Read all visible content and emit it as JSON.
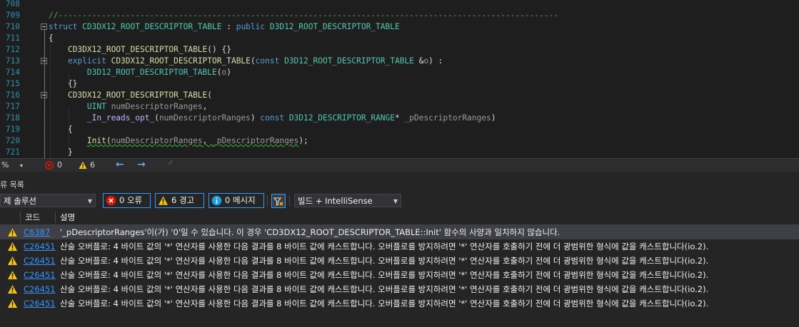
{
  "editor": {
    "lines": [
      {
        "n": "708",
        "t": []
      },
      {
        "n": "709",
        "t": [
          {
            "c": "comment",
            "s": "//--------------------------------------------------------------------------------------------------------"
          }
        ]
      },
      {
        "n": "710",
        "fold": true,
        "t": [
          {
            "c": "kw",
            "s": "struct "
          },
          {
            "c": "type",
            "s": "CD3DX12_ROOT_DESCRIPTOR_TABLE"
          },
          {
            "c": "plain",
            "s": " : "
          },
          {
            "c": "kw",
            "s": "public "
          },
          {
            "c": "type",
            "s": "D3D12_ROOT_DESCRIPTOR_TABLE"
          }
        ]
      },
      {
        "n": "711",
        "t": [
          {
            "c": "plain",
            "s": "{"
          }
        ]
      },
      {
        "n": "712",
        "t": [
          {
            "c": "plain",
            "s": "    "
          },
          {
            "c": "func",
            "s": "CD3DX12_ROOT_DESCRIPTOR_TABLE"
          },
          {
            "c": "plain",
            "s": "() {}"
          }
        ]
      },
      {
        "n": "713",
        "fold": true,
        "t": [
          {
            "c": "plain",
            "s": "    "
          },
          {
            "c": "kw",
            "s": "explicit "
          },
          {
            "c": "func",
            "s": "CD3DX12_ROOT_DESCRIPTOR_TABLE"
          },
          {
            "c": "plain",
            "s": "("
          },
          {
            "c": "kw",
            "s": "const "
          },
          {
            "c": "type",
            "s": "D3D12_ROOT_DESCRIPTOR_TABLE"
          },
          {
            "c": "plain",
            "s": " &"
          },
          {
            "c": "param",
            "s": "o"
          },
          {
            "c": "plain",
            "s": ") :"
          }
        ]
      },
      {
        "n": "714",
        "t": [
          {
            "c": "plain",
            "s": "        "
          },
          {
            "c": "type",
            "s": "D3D12_ROOT_DESCRIPTOR_TABLE"
          },
          {
            "c": "plain",
            "s": "("
          },
          {
            "c": "param",
            "s": "o"
          },
          {
            "c": "plain",
            "s": ")"
          }
        ]
      },
      {
        "n": "715",
        "t": [
          {
            "c": "plain",
            "s": "    {}"
          }
        ]
      },
      {
        "n": "716",
        "fold": true,
        "t": [
          {
            "c": "plain",
            "s": "    "
          },
          {
            "c": "func",
            "s": "CD3DX12_ROOT_DESCRIPTOR_TABLE"
          },
          {
            "c": "plain",
            "s": "("
          }
        ]
      },
      {
        "n": "717",
        "t": [
          {
            "c": "plain",
            "s": "        "
          },
          {
            "c": "type",
            "s": "UINT"
          },
          {
            "c": "plain",
            "s": " "
          },
          {
            "c": "param",
            "s": "numDescriptorRanges"
          },
          {
            "c": "plain",
            "s": ","
          }
        ]
      },
      {
        "n": "718",
        "t": [
          {
            "c": "plain",
            "s": "        "
          },
          {
            "c": "macro",
            "s": "_In_reads_opt_"
          },
          {
            "c": "plain",
            "s": "("
          },
          {
            "c": "param",
            "s": "numDescriptorRanges"
          },
          {
            "c": "plain",
            "s": ") "
          },
          {
            "c": "kw",
            "s": "const "
          },
          {
            "c": "type",
            "s": "D3D12_DESCRIPTOR_RANGE"
          },
          {
            "c": "plain",
            "s": "* "
          },
          {
            "c": "param",
            "s": "_pDescriptorRanges"
          },
          {
            "c": "plain",
            "s": ")"
          }
        ]
      },
      {
        "n": "719",
        "t": [
          {
            "c": "plain",
            "s": "    {"
          }
        ]
      },
      {
        "n": "720",
        "t": [
          {
            "c": "plain",
            "s": "        "
          },
          {
            "c": "func",
            "s": "Init",
            "sq": true
          },
          {
            "c": "plain",
            "s": "(",
            "sq": true
          },
          {
            "c": "param",
            "s": "numDescriptorRanges",
            "sq": true
          },
          {
            "c": "plain",
            "s": ", ",
            "sq": true
          },
          {
            "c": "param",
            "s": "_pDescriptorRanges",
            "sq": true
          },
          {
            "c": "plain",
            "s": ");"
          }
        ]
      },
      {
        "n": "721",
        "t": [
          {
            "c": "plain",
            "s": "    }"
          }
        ]
      }
    ]
  },
  "editor_status": {
    "zoom": "%",
    "errors": "0",
    "warnings": "6"
  },
  "panel": {
    "title": "류 목록"
  },
  "toolbar": {
    "scope": "제 솔루션",
    "errors_label": "0 오류",
    "warnings_label": "6 경고",
    "messages_label": "0 메시지",
    "build_filter": "빌드 + IntelliSense"
  },
  "columns": {
    "code": "코드",
    "description": "설명"
  },
  "rows": [
    {
      "code": "C6387",
      "desc": "'_pDescriptorRanges'이(가) '0'일 수 있습니다.  이 경우 'CD3DX12_ROOT_DESCRIPTOR_TABLE::Init' 함수의 사양과 일치하지 않습니다.",
      "selected": true
    },
    {
      "code": "C26451",
      "desc": "산술 오버플로: 4 바이트 값의 '*' 연산자를 사용한 다음 결과를 8 바이트 값에 캐스트합니다. 오버플로를 방지하려면 '*' 연산자를 호출하기 전에 더 광범위한 형식에 값을 캐스트합니다(io.2)."
    },
    {
      "code": "C26451",
      "desc": "산술 오버플로: 4 바이트 값의 '*' 연산자를 사용한 다음 결과를 8 바이트 값에 캐스트합니다. 오버플로를 방지하려면 '*' 연산자를 호출하기 전에 더 광범위한 형식에 값을 캐스트합니다(io.2)."
    },
    {
      "code": "C26451",
      "desc": "산술 오버플로: 4 바이트 값의 '*' 연산자를 사용한 다음 결과를 8 바이트 값에 캐스트합니다. 오버플로를 방지하려면 '*' 연산자를 호출하기 전에 더 광범위한 형식에 값을 캐스트합니다(io.2)."
    },
    {
      "code": "C26451",
      "desc": "산술 오버플로: 4 바이트 값의 '*' 연산자를 사용한 다음 결과를 8 바이트 값에 캐스트합니다. 오버플로를 방지하려면 '*' 연산자를 호출하기 전에 더 광범위한 형식에 값을 캐스트합니다(io.2)."
    },
    {
      "code": "C26451",
      "desc": "산술 오버플로: 4 바이트 값의 '*' 연산자를 사용한 다음 결과를 8 바이트 값에 캐스트합니다. 오버플로를 방지하려면 '*' 연산자를 호출하기 전에 더 광범위한 형식에 값을 캐스트합니다(io.2)."
    }
  ],
  "colors": {
    "accent": "#3399ff",
    "warning": "#f5c518",
    "error": "#e51400",
    "info": "#1ba1e2",
    "link": "#3794ff"
  }
}
